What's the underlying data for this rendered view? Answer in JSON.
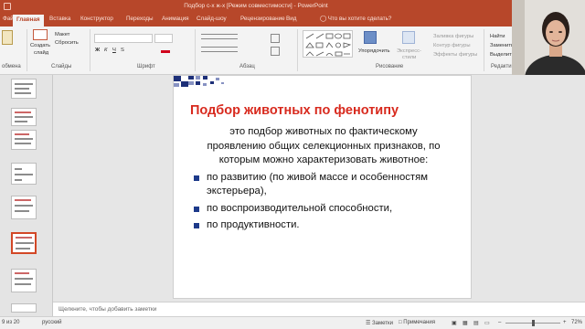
{
  "window": {
    "title": "Подбор с-х ж-х [Режим совместимости] - PowerPoint"
  },
  "tabs": [
    {
      "label": "Файл"
    },
    {
      "label": "Главная"
    },
    {
      "label": "Вставка"
    },
    {
      "label": "Конструктор"
    },
    {
      "label": "Переходы"
    },
    {
      "label": "Анимация"
    },
    {
      "label": "Слайд-шоу"
    },
    {
      "label": "Рецензирование"
    },
    {
      "label": "Вид"
    },
    {
      "label": "Что вы хотите сделать?"
    }
  ],
  "ribbon": {
    "clipboard": {
      "label": "обмена",
      "button": "Вставить"
    },
    "slides": {
      "label": "Слайды",
      "create": "Создать",
      "create2": "слайд",
      "layout": "Макет",
      "reset": "Сбросить"
    },
    "font": {
      "label": "Шрифт"
    },
    "paragraph": {
      "label": "Абзац"
    },
    "drawing": {
      "label": "Рисование",
      "arrange": "Упорядочить",
      "express": "Экспресс-",
      "styles": "стили",
      "fill": "Заливка фигуры",
      "outline": "Контур фигуры",
      "effects": "Эффекты фигуры"
    },
    "editing": {
      "label": "Редактирование",
      "find": "Найти",
      "replace": "Заменить",
      "select": "Выделить"
    }
  },
  "slide": {
    "title": "Подбор животных по фенотипу",
    "intro": "это подбор животных по фактическому проявлению общих селекционных признаков, по которым можно характеризовать животное:",
    "bullets": [
      "по развитию (по живой массе и особенностям экстерьера),",
      "по воспроизводительной способности,",
      "по продуктивности."
    ]
  },
  "notes": {
    "placeholder": "Щелкните, чтобы добавить заметки"
  },
  "status": {
    "slide": "9 из 20",
    "language": "русский",
    "notes": "Заметки",
    "comments": "Примечания",
    "zoom": "72%"
  },
  "colors": {
    "accent": "#b7472a",
    "title": "#d82a1e",
    "bullet": "#1d3a8a"
  }
}
